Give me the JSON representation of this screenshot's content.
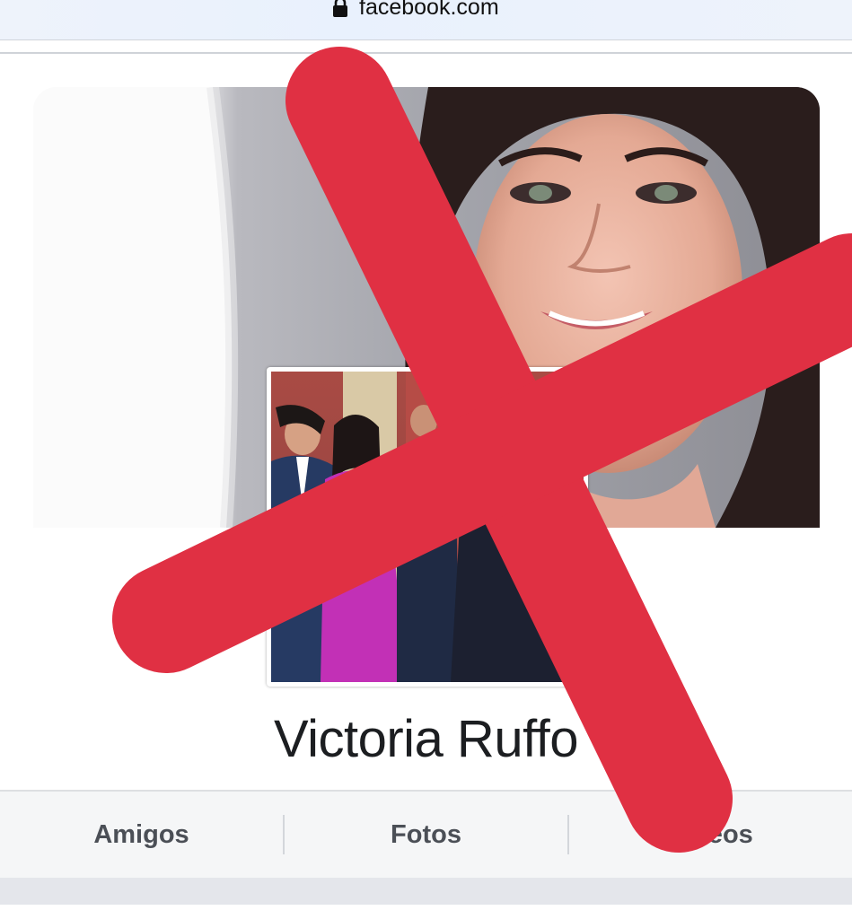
{
  "browser": {
    "url": "facebook.com",
    "lock_icon": "lock-icon"
  },
  "profile": {
    "name": "Victoria Ruffo",
    "cover_photo": "cover-photo",
    "profile_photo": "profile-photo"
  },
  "tabs": [
    {
      "label": "Amigos"
    },
    {
      "label": "Fotos"
    },
    {
      "label": "Videos"
    }
  ],
  "overlay": {
    "icon": "red-x-cross",
    "color": "#e03043"
  },
  "colors": {
    "name_text": "#1c1e21",
    "tab_text": "#4b4f56",
    "tab_bg": "#f5f6f7"
  }
}
